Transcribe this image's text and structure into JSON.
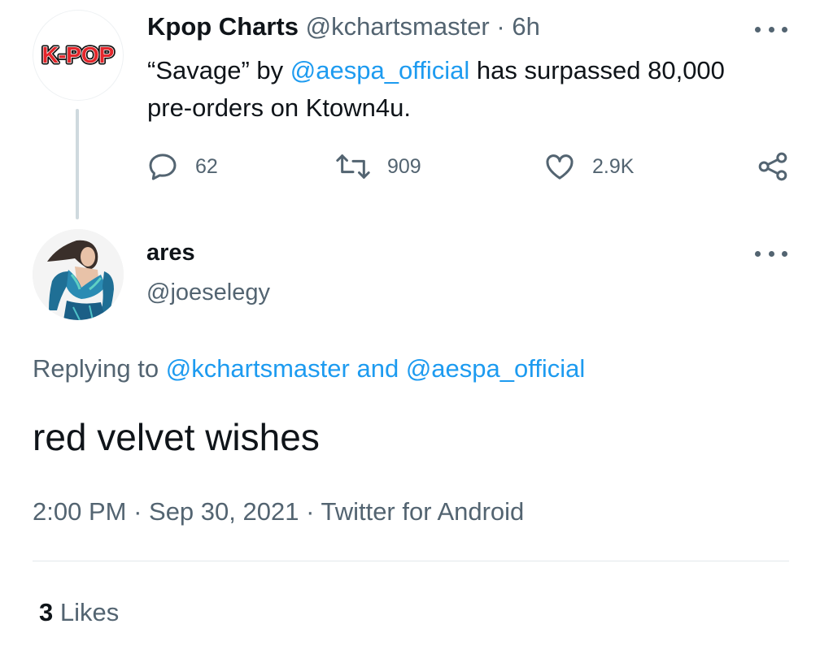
{
  "parent_tweet": {
    "avatar_text": "K-POP",
    "display_name": "Kpop Charts",
    "handle": "@kchartsmaster",
    "separator": "·",
    "time_ago": "6h",
    "text_before": "“Savage” by ",
    "mention": "@aespa_official",
    "text_after": " has surpassed 80,000 pre-orders on Ktown4u.",
    "reply_count": "62",
    "retweet_count": "909",
    "like_count": "2.9K"
  },
  "reply_tweet": {
    "display_name": "ares",
    "handle": "@joeselegy",
    "replying_prefix": "Replying to ",
    "replying_user1": "@kchartsmaster",
    "replying_and": " and ",
    "replying_user2": "@aespa_official",
    "text": "red velvet wishes",
    "time": "2:00 PM",
    "date": "Sep 30, 2021",
    "source": "Twitter for Android",
    "meta_sep": " · ",
    "likes_count": "3",
    "likes_label": " Likes"
  },
  "colors": {
    "link": "#1d9bf0",
    "muted": "#536471",
    "text": "#0f1419",
    "logo_red": "#e4262b"
  },
  "icons": {
    "reply": "speech-bubble-icon",
    "retweet": "retweet-arrows-icon",
    "like": "heart-icon",
    "share": "share-nodes-icon",
    "more": "more-dots-icon"
  }
}
